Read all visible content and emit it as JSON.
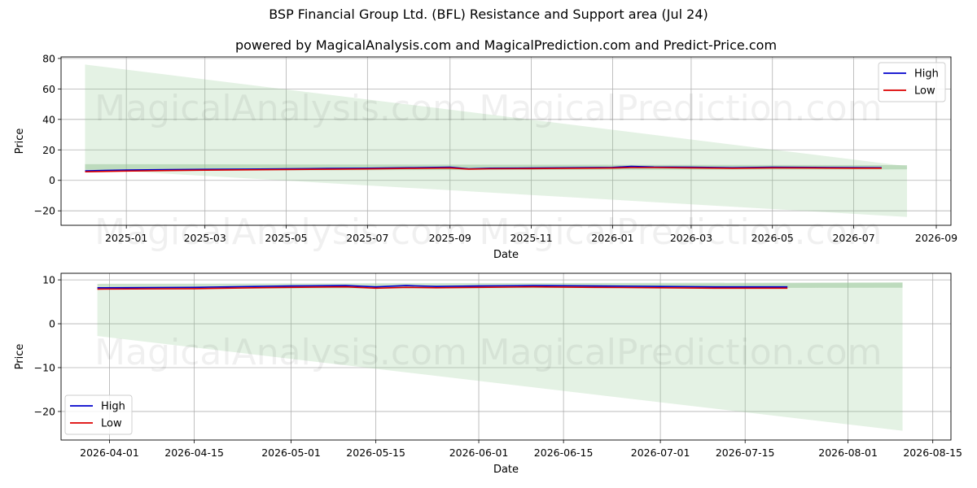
{
  "title": "BSP Financial Group Ltd. (BFL) Resistance and Support area (Jul 24)",
  "watermarks": [
    "MagicalAnalysis.com",
    "MagicalPrediction.com"
  ],
  "colors": {
    "high": "#0000cc",
    "low": "#dd0000",
    "band": "#90c890",
    "support": "#8fbf8f"
  },
  "chart_data": [
    {
      "type": "line",
      "title": "powered by MagicalAnalysis.com and MagicalPrediction.com and Predict-Price.com",
      "xlabel": "Date",
      "ylabel": "Price",
      "xlim": [
        "2024-11-13",
        "2026-09-12"
      ],
      "ylim": [
        -29.5,
        81
      ],
      "yticks": [
        -20,
        0,
        20,
        40,
        60,
        80
      ],
      "xtick_labels": [
        "2025-01",
        "2025-03",
        "2025-05",
        "2025-07",
        "2025-09",
        "2025-11",
        "2026-01",
        "2026-03",
        "2026-05",
        "2026-07",
        "2026-09"
      ],
      "legend_position": "upper right",
      "grid": true,
      "series": [
        {
          "name": "High",
          "points": [
            [
              "2024-12-01",
              6.2
            ],
            [
              "2025-01-01",
              6.8
            ],
            [
              "2025-02-01",
              7.0
            ],
            [
              "2025-03-01",
              7.2
            ],
            [
              "2025-04-01",
              7.4
            ],
            [
              "2025-05-01",
              7.6
            ],
            [
              "2025-06-01",
              7.8
            ],
            [
              "2025-07-01",
              8.0
            ],
            [
              "2025-08-01",
              8.3
            ],
            [
              "2025-09-01",
              8.6
            ],
            [
              "2025-09-15",
              7.6
            ],
            [
              "2025-10-01",
              8.0
            ],
            [
              "2025-11-01",
              8.1
            ],
            [
              "2025-12-01",
              8.3
            ],
            [
              "2026-01-01",
              8.5
            ],
            [
              "2026-01-15",
              9.2
            ],
            [
              "2026-02-01",
              8.8
            ],
            [
              "2026-03-01",
              8.6
            ],
            [
              "2026-04-01",
              8.3
            ],
            [
              "2026-05-01",
              8.6
            ],
            [
              "2026-06-01",
              8.5
            ],
            [
              "2026-07-01",
              8.4
            ],
            [
              "2026-07-22",
              8.3
            ]
          ]
        },
        {
          "name": "Low",
          "points": [
            [
              "2024-12-01",
              5.6
            ],
            [
              "2025-01-01",
              6.1
            ],
            [
              "2025-02-01",
              6.4
            ],
            [
              "2025-03-01",
              6.7
            ],
            [
              "2025-04-01",
              6.9
            ],
            [
              "2025-05-01",
              7.1
            ],
            [
              "2025-06-01",
              7.3
            ],
            [
              "2025-07-01",
              7.5
            ],
            [
              "2025-08-01",
              7.8
            ],
            [
              "2025-09-01",
              8.1
            ],
            [
              "2025-09-15",
              7.4
            ],
            [
              "2025-10-01",
              7.6
            ],
            [
              "2025-11-01",
              7.7
            ],
            [
              "2025-12-01",
              7.9
            ],
            [
              "2026-01-01",
              8.1
            ],
            [
              "2026-01-15",
              8.4
            ],
            [
              "2026-02-01",
              8.4
            ],
            [
              "2026-03-01",
              8.2
            ],
            [
              "2026-04-01",
              7.9
            ],
            [
              "2026-05-01",
              8.2
            ],
            [
              "2026-06-01",
              8.1
            ],
            [
              "2026-07-01",
              8.0
            ],
            [
              "2026-07-22",
              8.0
            ]
          ]
        }
      ],
      "resistance_band": {
        "x": [
          "2024-12-01",
          "2026-08-10"
        ],
        "upper": [
          10.6,
          10.0
        ],
        "lower": [
          6.4,
          7.2
        ]
      },
      "projection_area": {
        "x": [
          "2024-12-01",
          "2026-08-10"
        ],
        "upper": [
          76,
          9.3
        ],
        "lower": [
          7.5,
          -24
        ]
      }
    },
    {
      "type": "line",
      "xlabel": "Date",
      "ylabel": "Price",
      "xlim": [
        "2026-03-24",
        "2026-08-18"
      ],
      "ylim": [
        -26.5,
        11.5
      ],
      "yticks": [
        -20,
        -10,
        0,
        10
      ],
      "xtick_labels": [
        "2026-04-01",
        "2026-04-15",
        "2026-05-01",
        "2026-05-15",
        "2026-06-01",
        "2026-06-15",
        "2026-07-01",
        "2026-07-15",
        "2026-08-01",
        "2026-08-15"
      ],
      "legend_position": "lower left",
      "grid": true,
      "series": [
        {
          "name": "High",
          "points": [
            [
              "2026-03-30",
              8.2
            ],
            [
              "2026-04-15",
              8.3
            ],
            [
              "2026-04-25",
              8.5
            ],
            [
              "2026-05-01",
              8.6
            ],
            [
              "2026-05-10",
              8.7
            ],
            [
              "2026-05-15",
              8.4
            ],
            [
              "2026-05-20",
              8.7
            ],
            [
              "2026-05-25",
              8.5
            ],
            [
              "2026-06-01",
              8.6
            ],
            [
              "2026-06-10",
              8.7
            ],
            [
              "2026-06-20",
              8.6
            ],
            [
              "2026-07-01",
              8.5
            ],
            [
              "2026-07-10",
              8.4
            ],
            [
              "2026-07-22",
              8.4
            ]
          ]
        },
        {
          "name": "Low",
          "points": [
            [
              "2026-03-30",
              7.9
            ],
            [
              "2026-04-15",
              8.0
            ],
            [
              "2026-04-25",
              8.2
            ],
            [
              "2026-05-01",
              8.3
            ],
            [
              "2026-05-10",
              8.4
            ],
            [
              "2026-05-15",
              8.1
            ],
            [
              "2026-05-20",
              8.3
            ],
            [
              "2026-05-25",
              8.2
            ],
            [
              "2026-06-01",
              8.3
            ],
            [
              "2026-06-10",
              8.4
            ],
            [
              "2026-06-20",
              8.3
            ],
            [
              "2026-07-01",
              8.2
            ],
            [
              "2026-07-10",
              8.1
            ],
            [
              "2026-07-22",
              8.1
            ]
          ]
        }
      ],
      "resistance_band": {
        "x": [
          "2026-03-30",
          "2026-08-10"
        ],
        "upper": [
          9.1,
          9.4
        ],
        "lower": [
          8.0,
          8.2
        ]
      },
      "projection_area": {
        "x": [
          "2026-03-30",
          "2026-08-10"
        ],
        "upper": [
          8.2,
          9.4
        ],
        "lower": [
          -2.8,
          -24.4
        ]
      }
    }
  ]
}
